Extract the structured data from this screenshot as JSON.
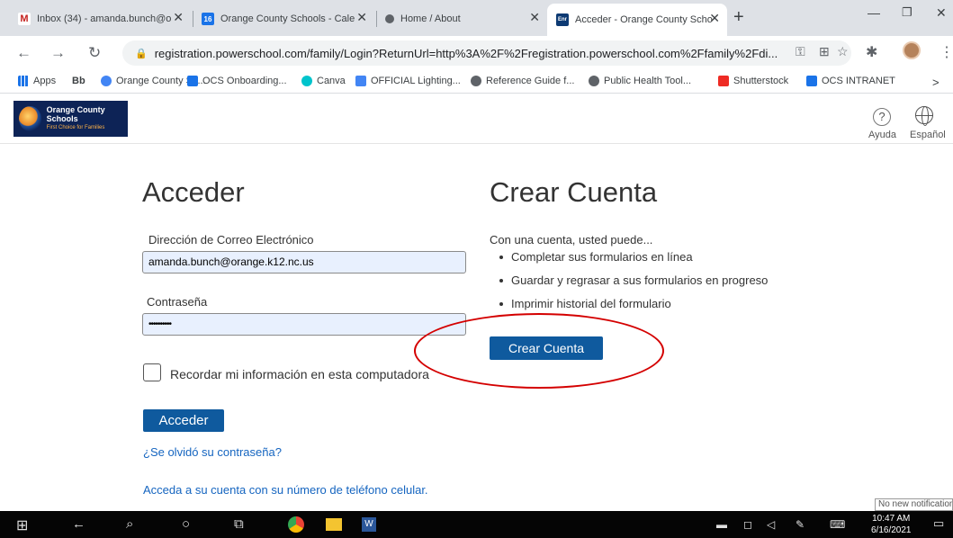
{
  "browser": {
    "tabs": [
      {
        "label": "Inbox (34) - amanda.bunch@o",
        "icon": "gmail-icon",
        "color": "#c5221f"
      },
      {
        "label": "Orange County Schools - Cale",
        "icon": "calendar-icon",
        "color": "#1a73e8",
        "badge": "16"
      },
      {
        "label": "Home / About",
        "icon": "chrome-web-icon",
        "color": "#5f6368"
      },
      {
        "label": "Acceder - Orange County Scho",
        "icon": "enr-icon",
        "color": "#0d3a73",
        "badge": "Enr",
        "active": true
      }
    ],
    "new_tab": "+",
    "url": "registration.powerschool.com/family/Login?ReturnUrl=http%3A%2F%2Fregistration.powerschool.com%2Ffamily%2Fdi...",
    "bookmarks": [
      {
        "label": "Apps",
        "icon": "apps-grid-icon",
        "color": "#1a73e8"
      },
      {
        "label": "Bb",
        "icon": "blackboard-icon",
        "color": "#000000"
      },
      {
        "label": "Orange County Sc...",
        "icon": "chrome-icon",
        "color": "#4285f4"
      },
      {
        "label": "OCS Onboarding...",
        "icon": "calendar-icon",
        "color": "#1a73e8"
      },
      {
        "label": "Canva",
        "icon": "canva-icon",
        "color": "#00c4cc"
      },
      {
        "label": "OFFICIAL Lighting...",
        "icon": "docs-icon",
        "color": "#4285f4"
      },
      {
        "label": "Reference Guide f...",
        "icon": "grey-site-icon",
        "color": "#5f6368"
      },
      {
        "label": "Public Health Tool...",
        "icon": "grey-site-icon",
        "color": "#5f6368"
      },
      {
        "label": "Shutterstock",
        "icon": "shutterstock-icon",
        "color": "#ee2b24"
      },
      {
        "label": "OCS INTRANET",
        "icon": "intranet-icon",
        "color": "#1a73e8"
      }
    ],
    "more_bookmarks": ">"
  },
  "header": {
    "logo_title": "Orange County Schools",
    "logo_tagline": "First Choice for Families",
    "help_label": "Ayuda",
    "language_label": "Español",
    "help_glyph": "?"
  },
  "login": {
    "title": "Acceder",
    "email_label": "Dirección de Correo Electrónico",
    "email_value": "amanda.bunch@orange.k12.nc.us",
    "password_label": "Contraseña",
    "password_value": "••••••••••",
    "remember_label": "Recordar mi información en esta computadora",
    "submit_label": "Acceder",
    "forgot_link": "¿Se olvidó su contraseña?",
    "phone_link": "Acceda a su cuenta con su número de teléfono celular."
  },
  "create": {
    "title": "Crear Cuenta",
    "intro": "Con una cuenta, usted puede...",
    "bullets": [
      "Completar sus formularios en línea",
      "Guardar y regrasar a sus formularios en progreso",
      "Imprimir historial del formulario"
    ],
    "button_label": "Crear Cuenta",
    "annotation_color": "#d40000"
  },
  "taskbar": {
    "notification": "No new notification",
    "time": "10:47 AM",
    "date": "6/16/2021"
  }
}
